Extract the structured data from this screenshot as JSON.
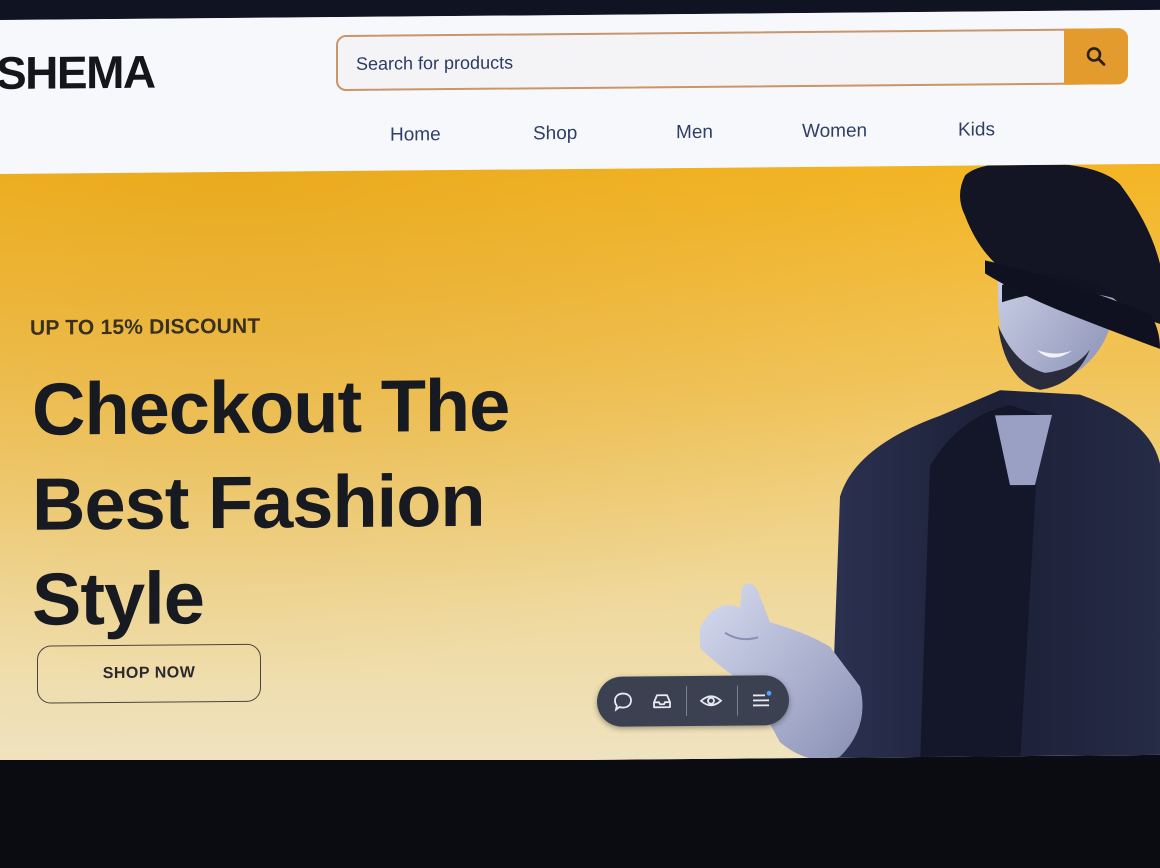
{
  "site": {
    "logo": "SHEMA"
  },
  "search": {
    "placeholder": "Search for products",
    "button_icon": "search-icon"
  },
  "nav": {
    "items": [
      {
        "label": "Home"
      },
      {
        "label": "Shop"
      },
      {
        "label": "Men"
      },
      {
        "label": "Women"
      },
      {
        "label": "Kids"
      }
    ]
  },
  "hero": {
    "eyebrow": "UP TO 15% DISCOUNT",
    "headline_line1": "Checkout The",
    "headline_line2": "Best Fashion",
    "headline_line3": "Style",
    "cta_label": "SHOP NOW"
  },
  "floating_toolbar": {
    "icons": [
      "chat-bubble-icon",
      "inbox-tray-icon",
      "eye-icon",
      "menu-list-icon"
    ]
  },
  "colors": {
    "accent": "#e39b2e",
    "hero_top": "#f4b524",
    "hero_bottom": "#efe3c2",
    "nav_text": "#2e3f68",
    "headline_text": "#181a22",
    "toolbar_bg": "#3b4150"
  }
}
